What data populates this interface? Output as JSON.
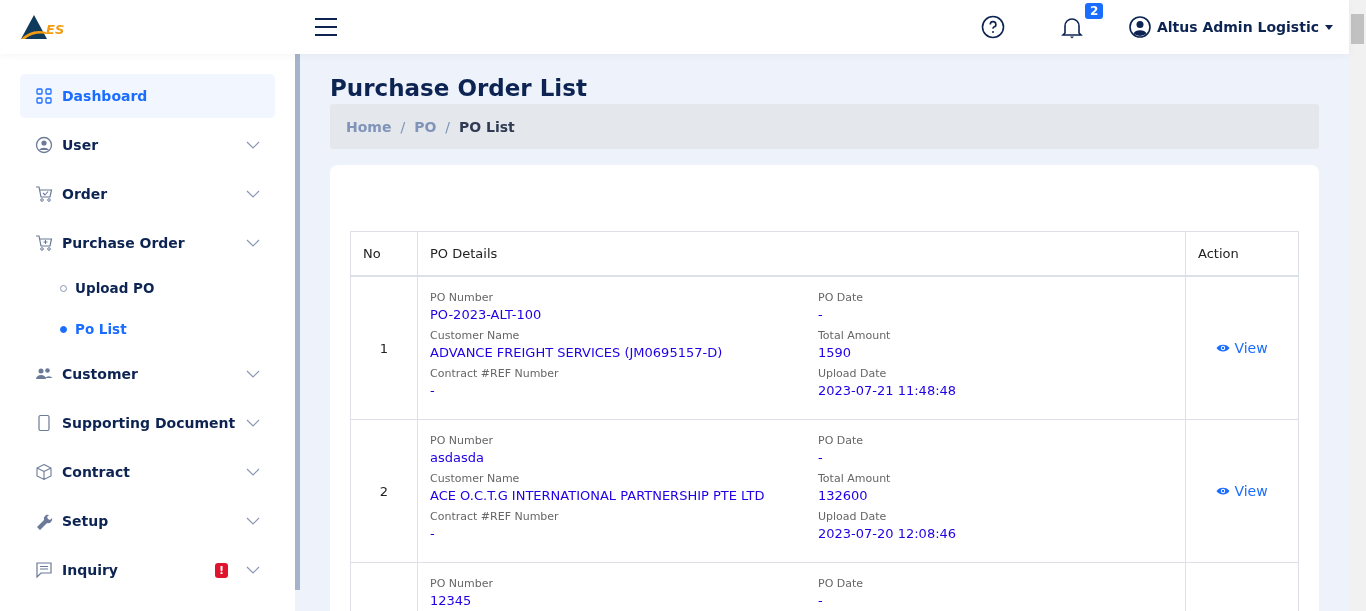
{
  "header": {
    "logo_text": "ES",
    "notifications": {
      "count": "2"
    },
    "user": {
      "name": "Altus Admin Logistic"
    }
  },
  "sidebar": {
    "items": [
      {
        "label": "Dashboard",
        "selected": true
      },
      {
        "label": "User",
        "selected": false
      },
      {
        "label": "Order",
        "selected": false
      },
      {
        "label": "Purchase Order",
        "selected": false,
        "children": [
          {
            "label": "Upload PO",
            "selected": false
          },
          {
            "label": "Po List",
            "selected": true
          }
        ]
      },
      {
        "label": "Customer",
        "selected": false
      },
      {
        "label": "Supporting Document",
        "selected": false
      },
      {
        "label": "Contract",
        "selected": false
      },
      {
        "label": "Setup",
        "selected": false
      },
      {
        "label": "Inquiry",
        "selected": false,
        "badge": "!"
      }
    ]
  },
  "page": {
    "title": "Purchase Order List",
    "breadcrumb": [
      "Home",
      "PO",
      "PO List"
    ],
    "breadcrumb_separator": "/"
  },
  "table": {
    "columns": [
      "No",
      "PO Details",
      "Action"
    ],
    "rows": [
      {
        "no": "1",
        "left": [
          {
            "label": "PO Number",
            "value": "PO-2023-ALT-100"
          },
          {
            "label": "Customer Name",
            "value": "ADVANCE FREIGHT SERVICES (JM0695157-D)"
          },
          {
            "label": "Contract #REF Number",
            "value": "-"
          }
        ],
        "right": [
          {
            "label": "PO Date",
            "value": "-"
          },
          {
            "label": "Total Amount",
            "value": "1590"
          },
          {
            "label": "Upload Date",
            "value": "2023-07-21 11:48:48"
          }
        ],
        "action": "View"
      },
      {
        "no": "2",
        "left": [
          {
            "label": "PO Number",
            "value": "asdasda"
          },
          {
            "label": "Customer Name",
            "value": "ACE O.C.T.G INTERNATIONAL PARTNERSHIP PTE LTD"
          },
          {
            "label": "Contract #REF Number",
            "value": "-"
          }
        ],
        "right": [
          {
            "label": "PO Date",
            "value": "-"
          },
          {
            "label": "Total Amount",
            "value": "132600"
          },
          {
            "label": "Upload Date",
            "value": "2023-07-20 12:08:46"
          }
        ],
        "action": "View"
      },
      {
        "left": [
          {
            "label": "PO Number",
            "value": "12345"
          }
        ],
        "right": [
          {
            "label": "PO Date",
            "value": "-"
          }
        ]
      }
    ]
  }
}
